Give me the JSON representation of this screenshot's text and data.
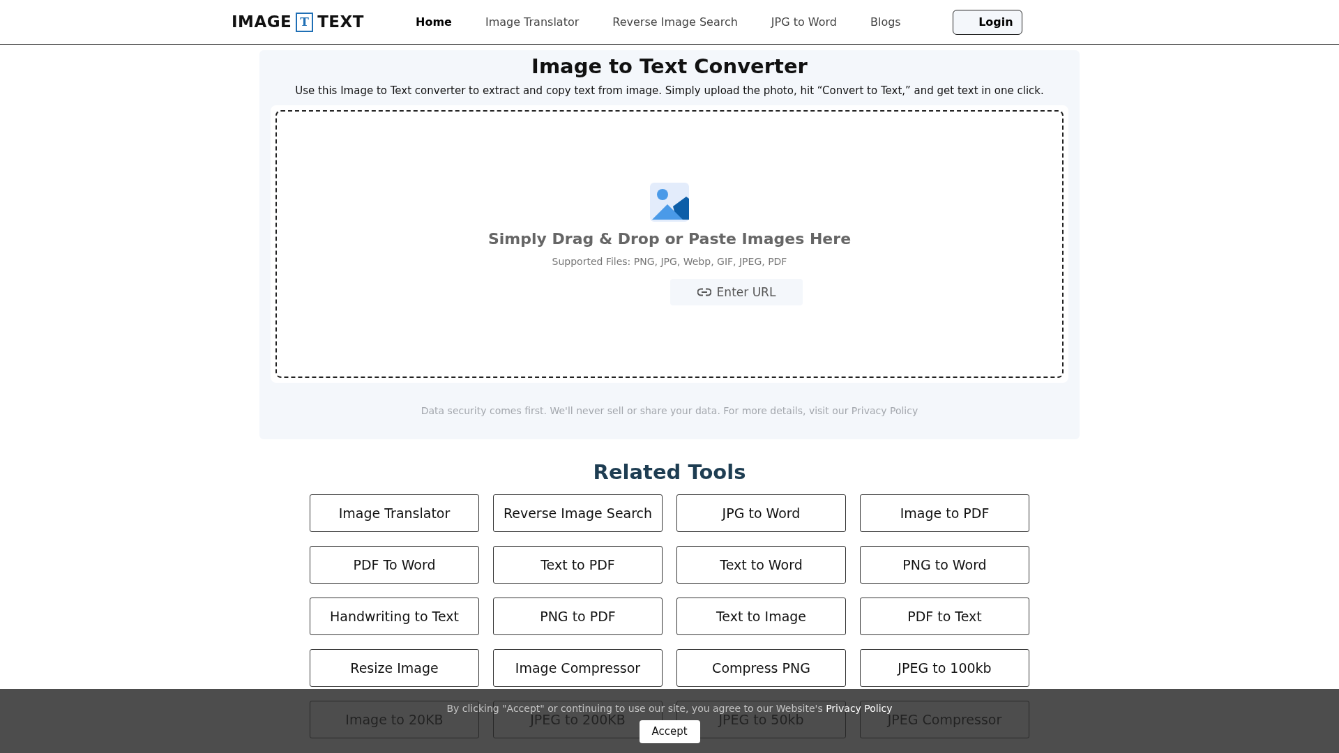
{
  "header": {
    "logo": {
      "left": "IMAGE",
      "mark": "T",
      "right": "TEXT"
    },
    "nav": [
      {
        "label": "Home",
        "selected": true
      },
      {
        "label": "Image Translator",
        "selected": false
      },
      {
        "label": "Reverse Image Search",
        "selected": false
      },
      {
        "label": "JPG to Word",
        "selected": false
      },
      {
        "label": "Blogs",
        "selected": false
      }
    ],
    "login": "Login"
  },
  "converter": {
    "title": "Image to Text Converter",
    "subtitle": "Use this Image to Text converter to extract and copy text from image. Simply upload the photo, hit “Convert to Text,” and get text in one click.",
    "dropzone": {
      "heading": "Simply Drag & Drop or Paste Images Here",
      "supported": "Supported Files: PNG, JPG, Webp, GIF, JPEG, PDF",
      "url_button": "Enter URL"
    },
    "privacy_note": "Data security comes first. We'll never sell or share your data. For more details, visit our Privacy Policy"
  },
  "related": {
    "title": "Related Tools",
    "tools": [
      "Image Translator",
      "Reverse Image Search",
      "JPG to Word",
      "Image to PDF",
      "PDF To Word",
      "Text to PDF",
      "Text to Word",
      "PNG to Word",
      "Handwriting to Text",
      "PNG to PDF",
      "Text to Image",
      "PDF to Text",
      "Resize Image",
      "Image Compressor",
      "Compress PNG",
      "JPEG to 100kb",
      "Image to 20KB",
      "JPEG to 200KB",
      "JPEG to 50kb",
      "JPEG Compressor"
    ]
  },
  "cookie_bar": {
    "text": "By clicking \"Accept\" or continuing to use our site, you agree to our Website's",
    "link": "Privacy Policy",
    "button": "Accept"
  }
}
